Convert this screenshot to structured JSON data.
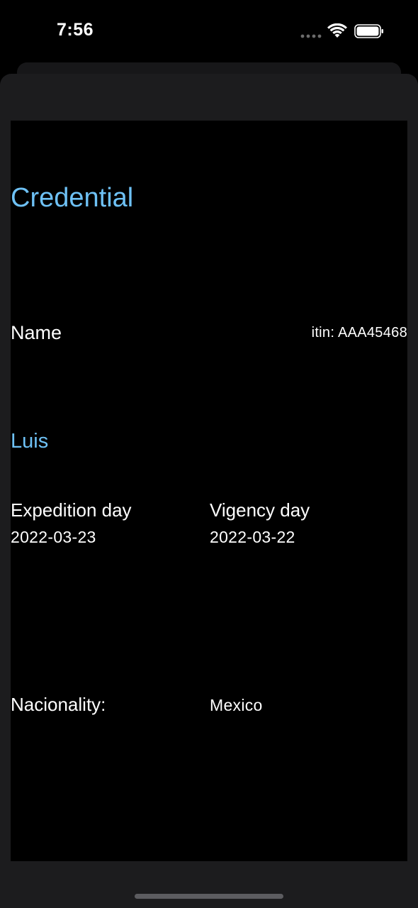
{
  "status_bar": {
    "time": "7:56",
    "icons": [
      "signal-dots-icon",
      "wifi-icon",
      "battery-icon"
    ]
  },
  "credential": {
    "title": "Credential",
    "name_label": "Name",
    "itin": "itin: AAA45468",
    "name_value": "Luis",
    "expedition_label": "Expedition day",
    "expedition_value": "2022-03-23",
    "vigency_label": "Vigency day",
    "vigency_value": "2022-03-22",
    "nationality_label": "Nacionality:",
    "nationality_value": "Mexico"
  },
  "colors": {
    "accent": "#6ec1f5",
    "sheet_background": "#1c1c1e",
    "card_background": "#000000",
    "text": "#ffffff"
  }
}
